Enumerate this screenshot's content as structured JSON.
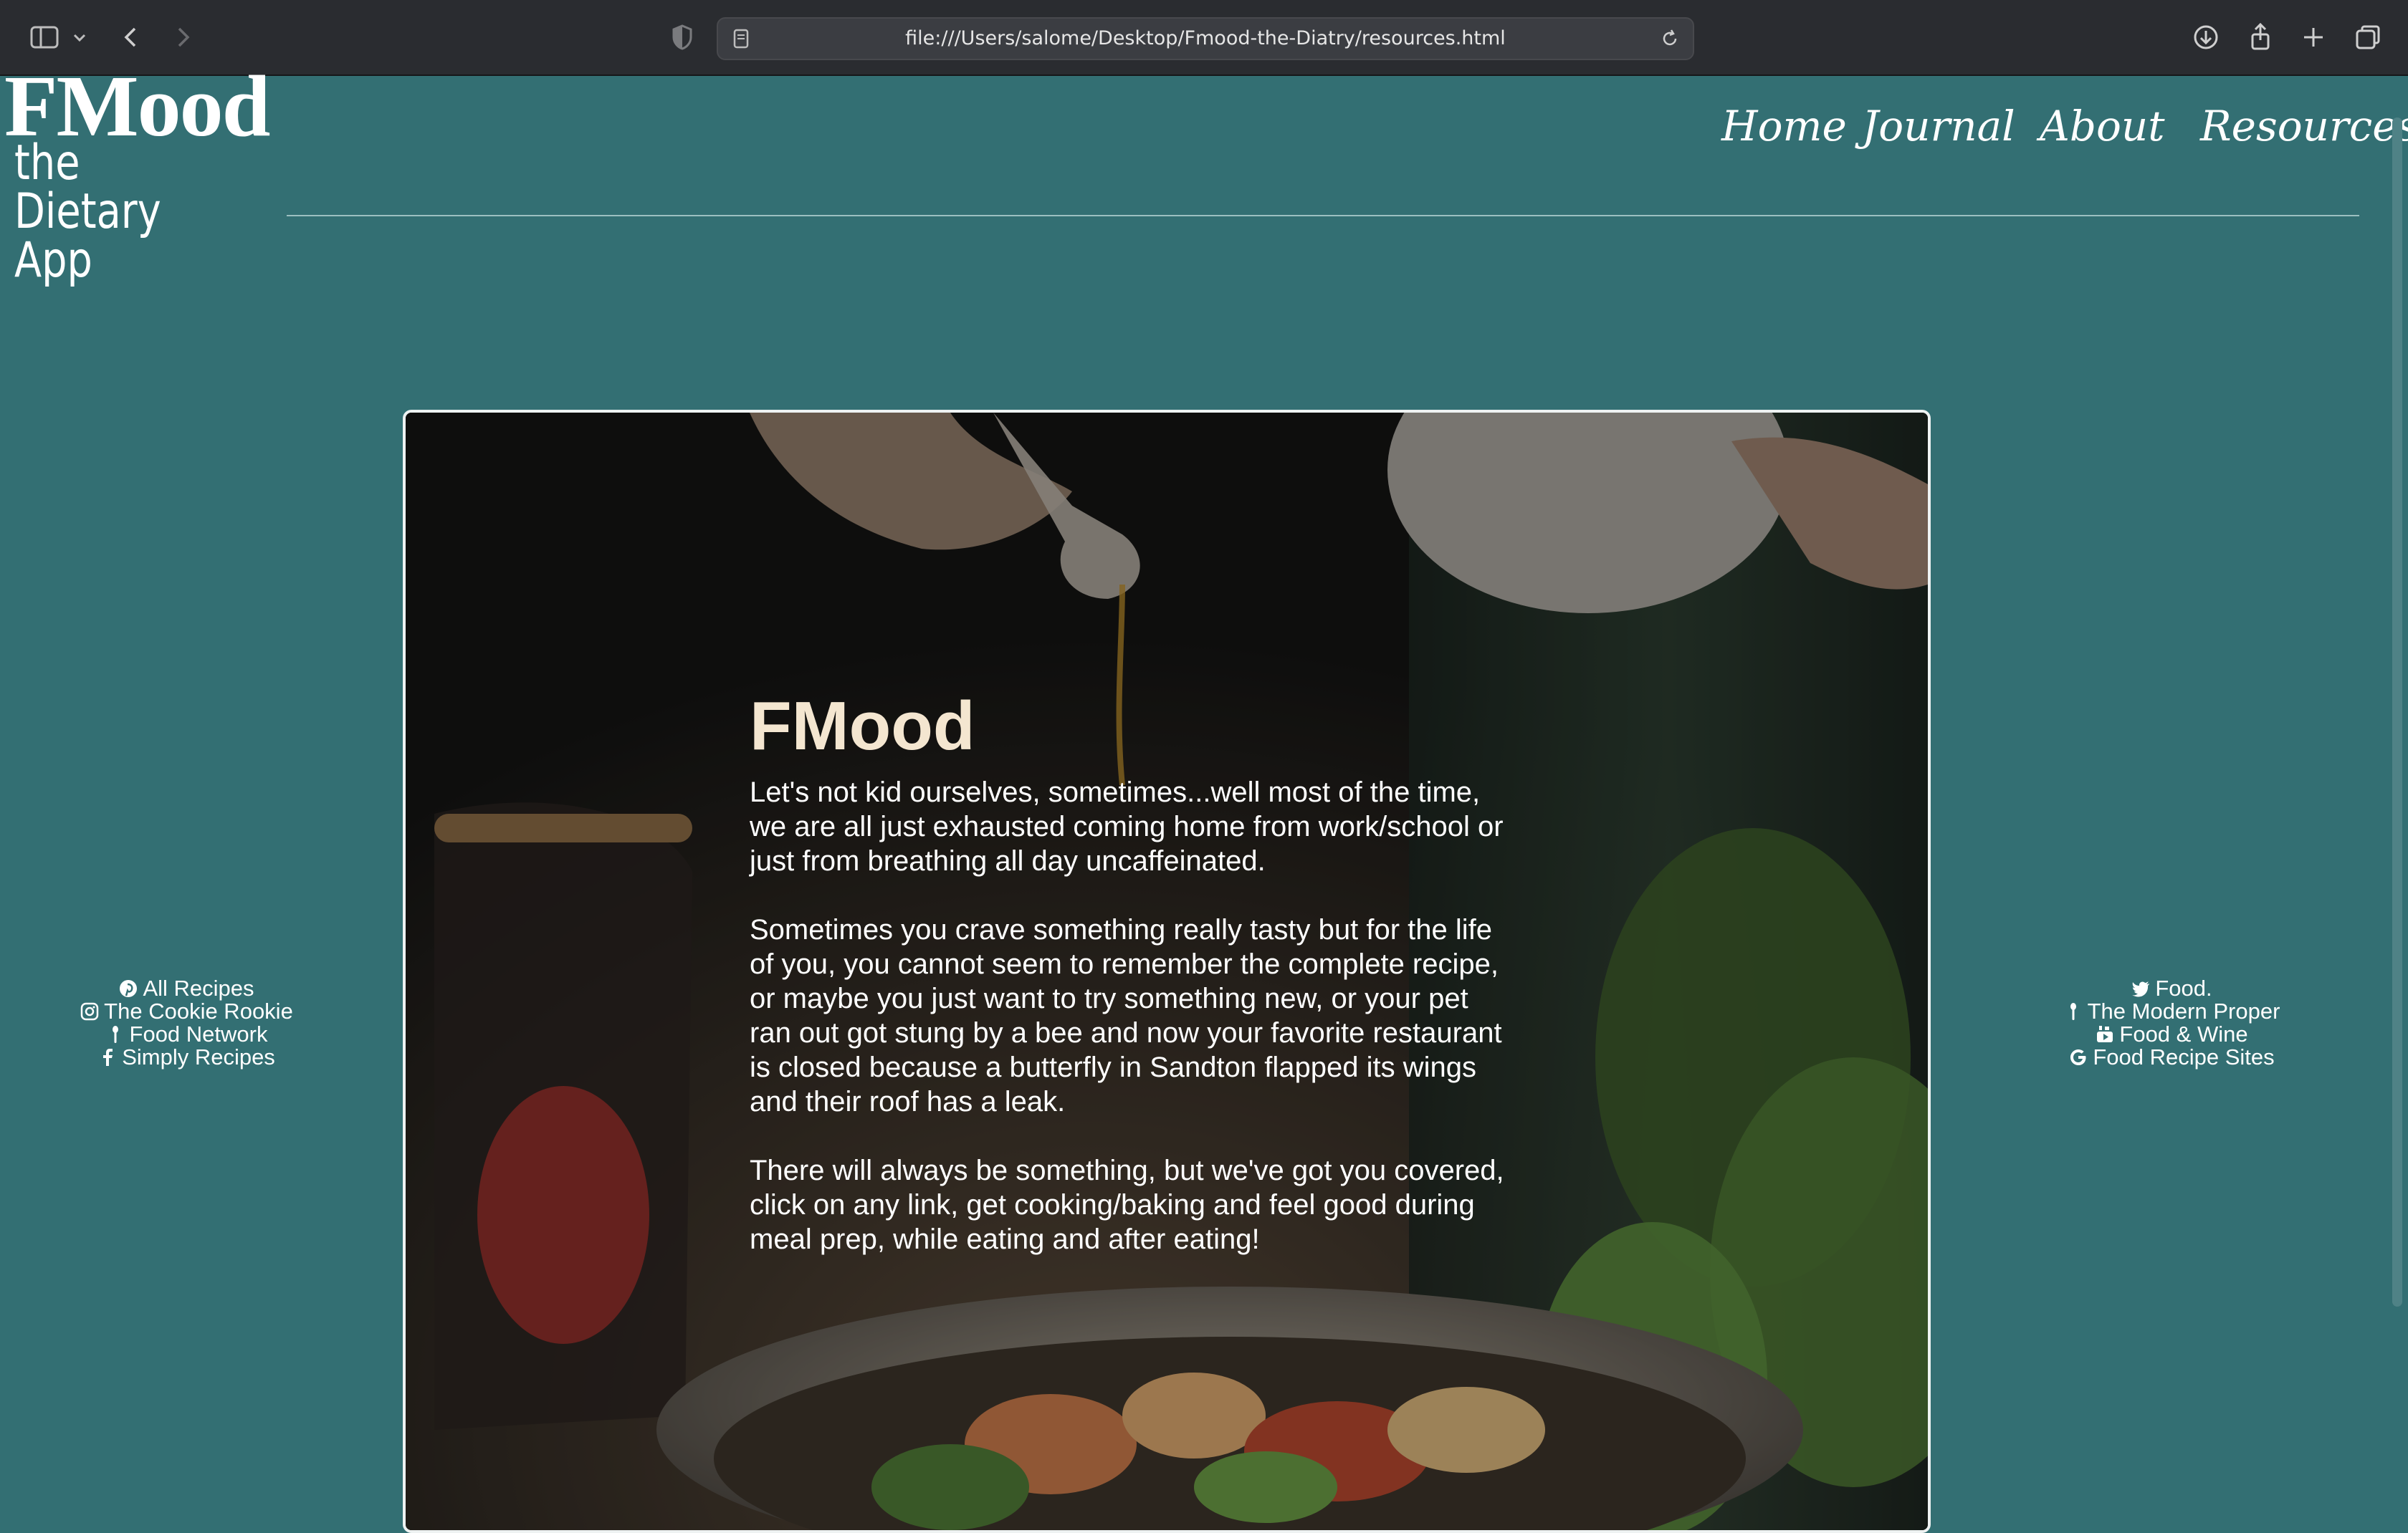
{
  "browser": {
    "url": "file:///Users/salome/Desktop/Fmood-the-Diatry/resources.html"
  },
  "logo": {
    "title": "FMood",
    "subtitle": "the Dietary App"
  },
  "nav": {
    "items": [
      {
        "label": "Home"
      },
      {
        "label": "Journal"
      },
      {
        "label": "About"
      },
      {
        "label": "Resources"
      }
    ]
  },
  "left_links": [
    {
      "label": "All Recipes",
      "icon": "pinterest-icon"
    },
    {
      "label": "The Cookie Rookie",
      "icon": "instagram-icon"
    },
    {
      "label": "Food Network",
      "icon": "spoon-icon"
    },
    {
      "label": "Simply Recipes",
      "icon": "facebook-icon"
    }
  ],
  "right_links": [
    {
      "label": "Food.",
      "icon": "twitter-icon"
    },
    {
      "label": "The Modern Proper",
      "icon": "spoon-icon"
    },
    {
      "label": "Food & Wine",
      "icon": "youtube-icon"
    },
    {
      "label": "Food Recipe Sites",
      "icon": "google-icon"
    }
  ],
  "hero": {
    "title": "FMood",
    "paragraphs": [
      "Let's not kid ourselves, sometimes...well most of the time, we are all just exhausted coming home from work/school or just from breathing all day uncaffeinated.",
      "Sometimes you crave something really tasty but for the life of you, you cannot seem to remember the complete recipe, or maybe you just want to try something new, or your pet ran out got stung by a bee and now your favorite restaurant is closed because a butterfly in Sandton flapped its wings and their roof has a leak.",
      "There will always be something, but we've got you covered, click on any link, get cooking/baking and feel good during meal prep, while eating and after eating!"
    ]
  },
  "colors": {
    "page_background": "#336f73",
    "hero_title": "#f4e6d0",
    "chrome": "#2a2c30"
  }
}
